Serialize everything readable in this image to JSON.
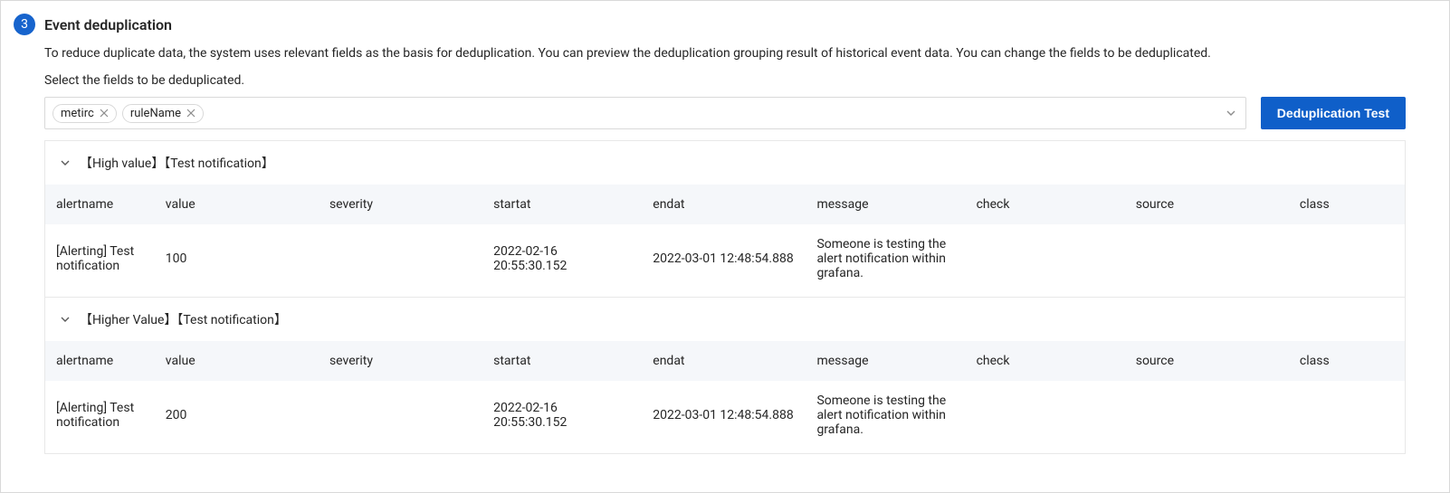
{
  "step": {
    "number": "3",
    "title": "Event deduplication",
    "description": "To reduce duplicate data, the system uses relevant fields as the basis for deduplication. You can preview the deduplication grouping result of historical event data. You can change the fields to be deduplicated.",
    "sub_label": "Select the fields to be deduplicated."
  },
  "tags": [
    {
      "label": "metirc"
    },
    {
      "label": "ruleName"
    }
  ],
  "button": {
    "dedup_test": "Deduplication Test"
  },
  "columns": {
    "alertname": "alertname",
    "value": "value",
    "severity": "severity",
    "startat": "startat",
    "endat": "endat",
    "message": "message",
    "check": "check",
    "source": "source",
    "class": "class"
  },
  "groups": [
    {
      "title": "【High value】【Test notification】",
      "rows": [
        {
          "alertname": "[Alerting] Test notification",
          "value": "100",
          "severity": "",
          "startat": "2022-02-16 20:55:30.152",
          "endat": "2022-03-01 12:48:54.888",
          "message": "Someone is testing the alert notification within grafana.",
          "check": "",
          "source": "",
          "class": ""
        }
      ]
    },
    {
      "title": "【Higher Value】【Test notification】",
      "rows": [
        {
          "alertname": "[Alerting] Test notification",
          "value": "200",
          "severity": "",
          "startat": "2022-02-16 20:55:30.152",
          "endat": "2022-03-01 12:48:54.888",
          "message": "Someone is testing the alert notification within grafana.",
          "check": "",
          "source": "",
          "class": ""
        }
      ]
    }
  ]
}
